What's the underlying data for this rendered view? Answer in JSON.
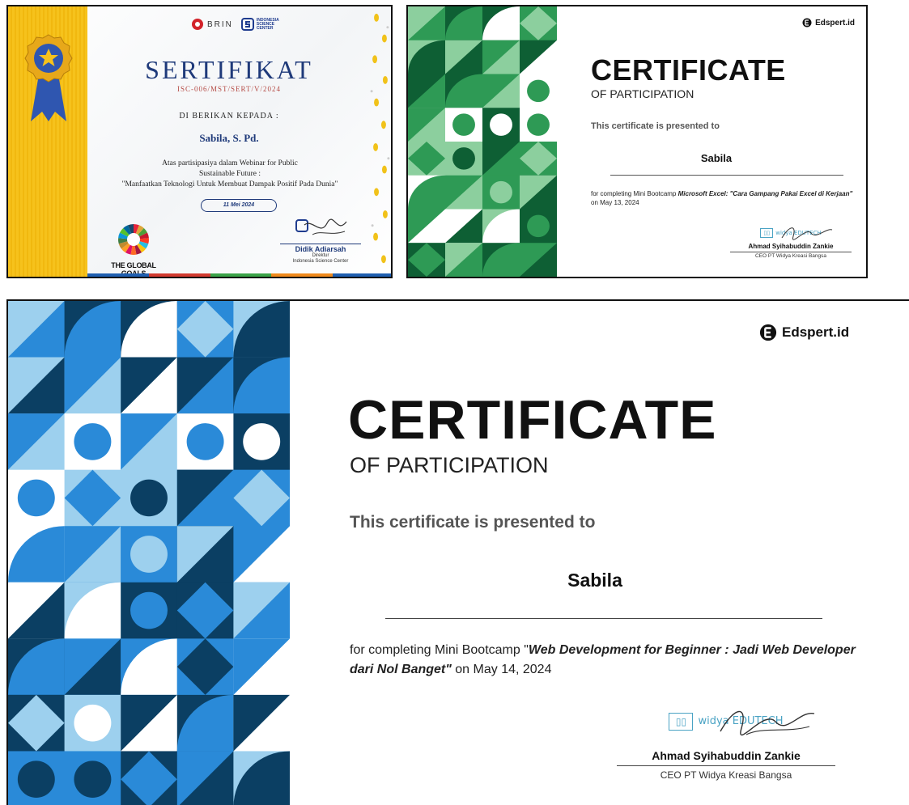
{
  "certificates": [
    {
      "id": "sertifikat",
      "logos": [
        "BRIN",
        "INDONESIA SCIENCE CENTER"
      ],
      "title": "SERTIFIKAT",
      "code": "ISC-006/MST/SERT/V/2024",
      "given_to_label": "DI BERIKAN KEPADA :",
      "recipient": "Sabila, S. Pd.",
      "description_line1": "Atas partisipasiya dalam Webinar for Public",
      "description_line2": "Sustainable Future :",
      "description_line3": "\"Manfaatkan Teknologi Untuk Membuat Dampak Positif Pada Dunia\"",
      "date": "11 Mei 2024",
      "global_goals_label": "THE GLOBAL GOALS",
      "signer_name": "Didik Adiarsah",
      "signer_role1": "Direktur",
      "signer_role2": "Indonesia Science Center",
      "colors": {
        "accent": "#1f3a7a",
        "ribbon": "#f6c21c",
        "code": "#b54b45"
      }
    },
    {
      "id": "green",
      "brand": "Edspert.id",
      "title": "CERTIFICATE",
      "subtitle": "OF PARTICIPATION",
      "presented_to": "This certificate is presented to",
      "recipient": "Sabila",
      "completing_prefix": "for completing Mini Bootcamp ",
      "course": "Microsoft Excel: \"Cara Gampang Pakai Excel di Kerjaan\"",
      "completing_suffix": " on May 13, 2024",
      "signer_logo": "widya EDUTECH",
      "signer_name": "Ahmad Syihabuddin Zankie",
      "signer_role": "CEO PT Widya Kreasi Bangsa",
      "colors": {
        "pattern_dark": "#0e5f34",
        "pattern_mid": "#2e9a55",
        "pattern_light": "#8ccf9e"
      }
    },
    {
      "id": "blue",
      "brand": "Edspert.id",
      "title": "CERTIFICATE",
      "subtitle": "OF PARTICIPATION",
      "presented_to": "This certificate is presented to",
      "recipient": "Sabila",
      "completing_prefix": "for completing Mini Bootcamp \"",
      "course": "Web Development for Beginner : Jadi Web Developer dari Nol Banget\"",
      "completing_suffix": " on May 14, 2024",
      "signer_logo": "widya EDUTECH",
      "signer_name": "Ahmad Syihabuddin Zankie",
      "signer_role": "CEO PT Widya Kreasi Bangsa",
      "colors": {
        "pattern_dark": "#0b3f63",
        "pattern_mid": "#2a8ad8",
        "pattern_light": "#9dd0ee"
      }
    }
  ]
}
